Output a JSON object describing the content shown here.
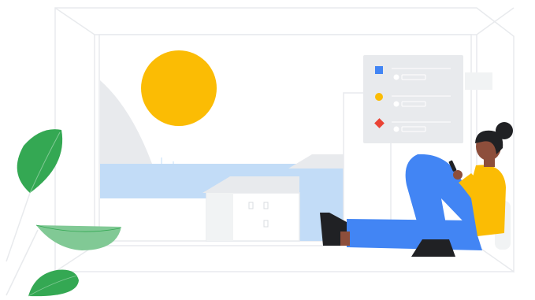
{
  "illustration": {
    "subject": "person-seated-with-phone-in-room",
    "colors": {
      "sun": "#FBBC04",
      "leaf": "#34A853",
      "leaf_light": "#81C995",
      "trousers": "#4285F4",
      "shirt": "#FBBC04",
      "skin": "#8D4E3B",
      "hair": "#202124",
      "water": "#C2DCF7",
      "wall": "#FFFFFF",
      "outline": "#E8EAED",
      "panel": "#E8EAED",
      "marker_blue": "#4285F4",
      "marker_yellow": "#FBBC04",
      "marker_red": "#EA4335"
    }
  },
  "checklist": {
    "items": [
      {
        "marker": "square",
        "color": "#4285F4"
      },
      {
        "marker": "circle",
        "color": "#FBBC04"
      },
      {
        "marker": "diamond",
        "color": "#EA4335"
      }
    ]
  }
}
